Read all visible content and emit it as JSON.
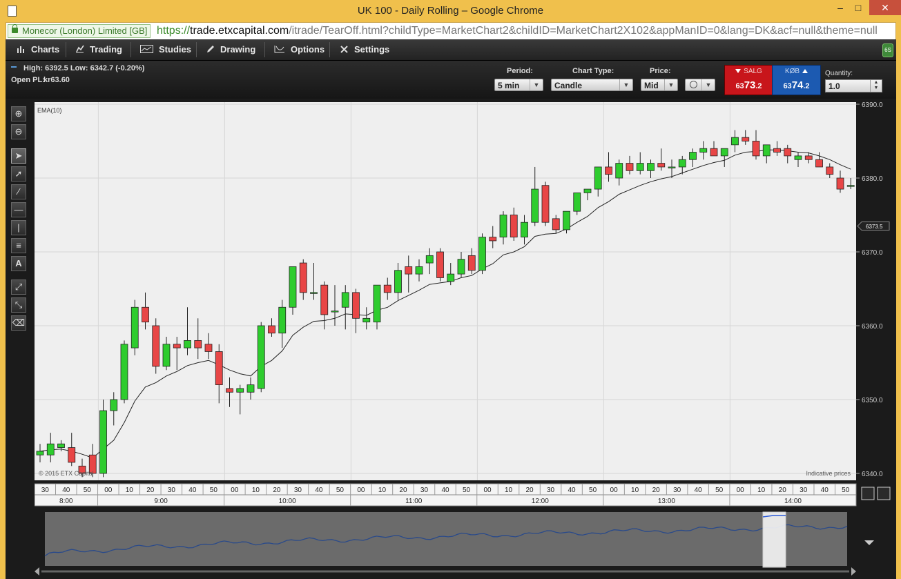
{
  "window": {
    "title": "UK 100 - Daily Rolling – Google Chrome",
    "min_icon": "minimize-icon",
    "max_icon": "maximize-icon",
    "close_icon": "close-icon"
  },
  "addressbar": {
    "cert_label": "Monecor (London)  Limited [GB]",
    "url_scheme": "https://",
    "url_host": "trade.etxcapital.com",
    "url_path": "/itrade/TearOff.html?childType=MarketChart2&childID=MarketChart2X102&appManID=0&lang=DK&acf=null&theme=null"
  },
  "menubar": {
    "items": [
      {
        "label": "Charts",
        "icon": "bar-chart-icon"
      },
      {
        "label": "Trading",
        "icon": "trading-icon"
      },
      {
        "label": "Studies",
        "icon": "studies-icon"
      },
      {
        "label": "Drawing",
        "icon": "pencil-icon"
      },
      {
        "label": "Options",
        "icon": "options-icon"
      },
      {
        "label": "Settings",
        "icon": "wrench-icon"
      }
    ],
    "badge": "6S"
  },
  "infobar": {
    "high_low": "High: 6392.5 Low: 6342.7 (-0.20%)",
    "open_pl_label": "Open PL:",
    "open_pl_value": "kr63.60",
    "period_label": "Period:",
    "period_value": "5 min",
    "chart_type_label": "Chart Type:",
    "chart_type_value": "Candle",
    "price_label": "Price:",
    "price_value": "Mid",
    "sell_label": "SALG",
    "sell_price_main": "63",
    "sell_price_big": "73",
    "sell_price_dec": ".2",
    "buy_label": "KØB",
    "buy_price_main": "63",
    "buy_price_big": "74",
    "buy_price_dec": ".2",
    "quantity_label": "Quantity:",
    "quantity_value": "1.0"
  },
  "toolbar": {
    "tools": [
      "zoom-in-icon",
      "zoom-out-icon",
      "pointer-icon",
      "trend-line-icon",
      "line-icon",
      "horizontal-line-icon",
      "vertical-line-icon",
      "fibonacci-icon",
      "text-icon",
      "expand-icon",
      "magnet-icon",
      "trash-icon"
    ]
  },
  "chart_data": {
    "type": "candlestick",
    "indicator_label": "EMA(10)",
    "copyright": "© 2015 ETX Capital",
    "note": "Indicative prices",
    "ylim": [
      6340,
      6390
    ],
    "y_ticks": [
      "6390.0",
      "6380.0",
      "6370.0",
      "6360.0",
      "6350.0",
      "6340.0"
    ],
    "current_price_tag": "6373.5",
    "x_minute_ticks": [
      "30",
      "40",
      "50",
      "00",
      "10",
      "20",
      "30",
      "40",
      "50",
      "00",
      "10",
      "20",
      "30",
      "40",
      "50",
      "00",
      "10",
      "20",
      "30",
      "40",
      "50",
      "00",
      "10",
      "20",
      "30",
      "40",
      "50",
      "00",
      "10",
      "20",
      "30",
      "40",
      "50",
      "00",
      "10",
      "20",
      "30",
      "40",
      "50"
    ],
    "x_hour_ticks": [
      "8:00",
      "9:00",
      "10:00",
      "11:00",
      "12:00",
      "13:00",
      "14:00"
    ],
    "candles": [
      {
        "o": 6342.5,
        "h": 6344.0,
        "l": 6341.5,
        "c": 6343.0
      },
      {
        "o": 6342.5,
        "h": 6345.5,
        "l": 6341.5,
        "c": 6344.0
      },
      {
        "o": 6343.5,
        "h": 6344.5,
        "l": 6343.0,
        "c": 6344.0
      },
      {
        "o": 6343.5,
        "h": 6345.5,
        "l": 6341.0,
        "c": 6341.5
      },
      {
        "o": 6341.0,
        "h": 6342.0,
        "l": 6339.5,
        "c": 6340.0
      },
      {
        "o": 6342.5,
        "h": 6344.0,
        "l": 6339.5,
        "c": 6340.0
      },
      {
        "o": 6340.0,
        "h": 6350.0,
        "l": 6339.5,
        "c": 6348.5
      },
      {
        "o": 6348.5,
        "h": 6351.0,
        "l": 6346.5,
        "c": 6350.0
      },
      {
        "o": 6350.0,
        "h": 6358.0,
        "l": 6349.5,
        "c": 6357.5
      },
      {
        "o": 6357.0,
        "h": 6363.5,
        "l": 6356.0,
        "c": 6362.5
      },
      {
        "o": 6362.5,
        "h": 6364.5,
        "l": 6359.5,
        "c": 6360.5
      },
      {
        "o": 6360.0,
        "h": 6361.0,
        "l": 6353.5,
        "c": 6354.5
      },
      {
        "o": 6354.5,
        "h": 6358.5,
        "l": 6354.0,
        "c": 6357.5
      },
      {
        "o": 6357.5,
        "h": 6358.5,
        "l": 6354.0,
        "c": 6357.0
      },
      {
        "o": 6357.0,
        "h": 6362.5,
        "l": 6356.0,
        "c": 6358.0
      },
      {
        "o": 6358.0,
        "h": 6361.0,
        "l": 6355.5,
        "c": 6357.0
      },
      {
        "o": 6357.5,
        "h": 6359.0,
        "l": 6355.5,
        "c": 6356.5
      },
      {
        "o": 6356.5,
        "h": 6357.5,
        "l": 6349.5,
        "c": 6352.0
      },
      {
        "o": 6351.5,
        "h": 6353.0,
        "l": 6349.0,
        "c": 6351.0
      },
      {
        "o": 6351.0,
        "h": 6352.0,
        "l": 6348.0,
        "c": 6351.5
      },
      {
        "o": 6351.0,
        "h": 6353.0,
        "l": 6350.0,
        "c": 6352.0
      },
      {
        "o": 6351.5,
        "h": 6360.5,
        "l": 6351.0,
        "c": 6360.0
      },
      {
        "o": 6360.0,
        "h": 6361.0,
        "l": 6358.5,
        "c": 6359.0
      },
      {
        "o": 6359.0,
        "h": 6363.5,
        "l": 6357.0,
        "c": 6362.5
      },
      {
        "o": 6362.5,
        "h": 6368.0,
        "l": 6361.5,
        "c": 6368.0
      },
      {
        "o": 6368.5,
        "h": 6369.0,
        "l": 6363.5,
        "c": 6364.5
      },
      {
        "o": 6364.5,
        "h": 6368.5,
        "l": 6363.5,
        "c": 6364.5
      },
      {
        "o": 6365.5,
        "h": 6366.0,
        "l": 6359.5,
        "c": 6361.5
      },
      {
        "o": 6362.0,
        "h": 6365.5,
        "l": 6360.0,
        "c": 6362.0
      },
      {
        "o": 6362.5,
        "h": 6365.5,
        "l": 6359.5,
        "c": 6364.5
      },
      {
        "o": 6364.5,
        "h": 6365.0,
        "l": 6359.0,
        "c": 6361.0
      },
      {
        "o": 6360.5,
        "h": 6362.5,
        "l": 6359.5,
        "c": 6361.0
      },
      {
        "o": 6360.5,
        "h": 6365.5,
        "l": 6359.5,
        "c": 6365.5
      },
      {
        "o": 6365.5,
        "h": 6366.5,
        "l": 6363.5,
        "c": 6364.5
      },
      {
        "o": 6364.5,
        "h": 6368.5,
        "l": 6363.5,
        "c": 6367.5
      },
      {
        "o": 6368.0,
        "h": 6369.5,
        "l": 6364.5,
        "c": 6367.0
      },
      {
        "o": 6367.0,
        "h": 6369.0,
        "l": 6366.0,
        "c": 6368.0
      },
      {
        "o": 6368.5,
        "h": 6370.5,
        "l": 6367.0,
        "c": 6369.5
      },
      {
        "o": 6370.0,
        "h": 6370.5,
        "l": 6366.0,
        "c": 6366.5
      },
      {
        "o": 6366.0,
        "h": 6368.5,
        "l": 6365.5,
        "c": 6367.0
      },
      {
        "o": 6367.0,
        "h": 6370.0,
        "l": 6366.5,
        "c": 6369.0
      },
      {
        "o": 6369.5,
        "h": 6370.5,
        "l": 6367.0,
        "c": 6367.5
      },
      {
        "o": 6367.5,
        "h": 6372.5,
        "l": 6367.0,
        "c": 6372.0
      },
      {
        "o": 6372.0,
        "h": 6373.5,
        "l": 6370.5,
        "c": 6371.5
      },
      {
        "o": 6372.0,
        "h": 6375.5,
        "l": 6371.0,
        "c": 6375.0
      },
      {
        "o": 6375.0,
        "h": 6376.0,
        "l": 6371.5,
        "c": 6372.0
      },
      {
        "o": 6372.0,
        "h": 6375.0,
        "l": 6371.0,
        "c": 6374.0
      },
      {
        "o": 6374.0,
        "h": 6381.5,
        "l": 6373.5,
        "c": 6378.5
      },
      {
        "o": 6379.0,
        "h": 6379.5,
        "l": 6373.5,
        "c": 6374.0
      },
      {
        "o": 6374.5,
        "h": 6375.0,
        "l": 6372.5,
        "c": 6373.0
      },
      {
        "o": 6373.0,
        "h": 6375.5,
        "l": 6372.5,
        "c": 6375.5
      },
      {
        "o": 6375.5,
        "h": 6378.0,
        "l": 6375.0,
        "c": 6378.0
      },
      {
        "o": 6378.0,
        "h": 6378.5,
        "l": 6377.0,
        "c": 6378.5
      },
      {
        "o": 6378.5,
        "h": 6381.5,
        "l": 6377.5,
        "c": 6381.5
      },
      {
        "o": 6381.5,
        "h": 6383.5,
        "l": 6379.5,
        "c": 6380.5
      },
      {
        "o": 6380.0,
        "h": 6382.5,
        "l": 6379.0,
        "c": 6382.0
      },
      {
        "o": 6382.0,
        "h": 6383.0,
        "l": 6380.5,
        "c": 6381.0
      },
      {
        "o": 6381.0,
        "h": 6383.5,
        "l": 6380.5,
        "c": 6382.0
      },
      {
        "o": 6381.0,
        "h": 6382.5,
        "l": 6380.0,
        "c": 6382.0
      },
      {
        "o": 6382.0,
        "h": 6384.0,
        "l": 6381.0,
        "c": 6381.5
      },
      {
        "o": 6381.5,
        "h": 6382.5,
        "l": 6380.0,
        "c": 6381.5
      },
      {
        "o": 6381.5,
        "h": 6383.0,
        "l": 6380.5,
        "c": 6382.5
      },
      {
        "o": 6382.5,
        "h": 6384.0,
        "l": 6381.5,
        "c": 6383.5
      },
      {
        "o": 6383.5,
        "h": 6385.0,
        "l": 6382.5,
        "c": 6384.0
      },
      {
        "o": 6384.0,
        "h": 6385.0,
        "l": 6383.0,
        "c": 6383.0
      },
      {
        "o": 6383.0,
        "h": 6384.0,
        "l": 6381.5,
        "c": 6384.0
      },
      {
        "o": 6384.5,
        "h": 6386.5,
        "l": 6383.5,
        "c": 6385.5
      },
      {
        "o": 6385.5,
        "h": 6386.5,
        "l": 6384.5,
        "c": 6385.0
      },
      {
        "o": 6385.0,
        "h": 6386.5,
        "l": 6382.5,
        "c": 6383.0
      },
      {
        "o": 6383.0,
        "h": 6384.5,
        "l": 6382.0,
        "c": 6384.5
      },
      {
        "o": 6384.0,
        "h": 6385.0,
        "l": 6383.0,
        "c": 6383.5
      },
      {
        "o": 6384.0,
        "h": 6384.5,
        "l": 6382.0,
        "c": 6383.0
      },
      {
        "o": 6382.5,
        "h": 6383.5,
        "l": 6381.5,
        "c": 6383.0
      },
      {
        "o": 6383.0,
        "h": 6383.5,
        "l": 6382.0,
        "c": 6382.5
      },
      {
        "o": 6382.5,
        "h": 6383.5,
        "l": 6381.5,
        "c": 6381.5
      },
      {
        "o": 6381.5,
        "h": 6382.0,
        "l": 6380.0,
        "c": 6380.5
      },
      {
        "o": 6380.0,
        "h": 6381.0,
        "l": 6378.0,
        "c": 6378.5
      },
      {
        "o": 6379.0,
        "h": 6380.0,
        "l": 6378.5,
        "c": 6379.0
      }
    ],
    "ema": [
      6343.0,
      6343.2,
      6343.3,
      6343.0,
      6342.6,
      6342.1,
      6343.3,
      6344.5,
      6346.9,
      6349.8,
      6351.7,
      6352.3,
      6353.2,
      6353.8,
      6354.6,
      6355.0,
      6355.3,
      6354.7,
      6354.0,
      6353.5,
      6353.2,
      6354.5,
      6355.3,
      6356.6,
      6358.7,
      6359.8,
      6360.6,
      6360.7,
      6361.0,
      6361.6,
      6361.5,
      6361.4,
      6362.1,
      6362.5,
      6363.4,
      6364.1,
      6364.8,
      6365.6,
      6365.8,
      6366.0,
      6366.5,
      6366.8,
      6367.7,
      6368.4,
      6369.6,
      6370.0,
      6370.7,
      6372.1,
      6372.4,
      6372.5,
      6373.1,
      6374.0,
      6374.8,
      6376.0,
      6376.8,
      6377.8,
      6378.4,
      6379.0,
      6379.5,
      6379.9,
      6380.2,
      6380.7,
      6381.2,
      6381.7,
      6382.1,
      6382.4,
      6383.1,
      6383.5,
      6383.6,
      6383.8,
      6383.8,
      6383.7,
      6383.5,
      6383.4,
      6383.0,
      6382.5,
      6381.8,
      6381.2
    ],
    "navigator_icon": "navigator-collapse-icon"
  }
}
